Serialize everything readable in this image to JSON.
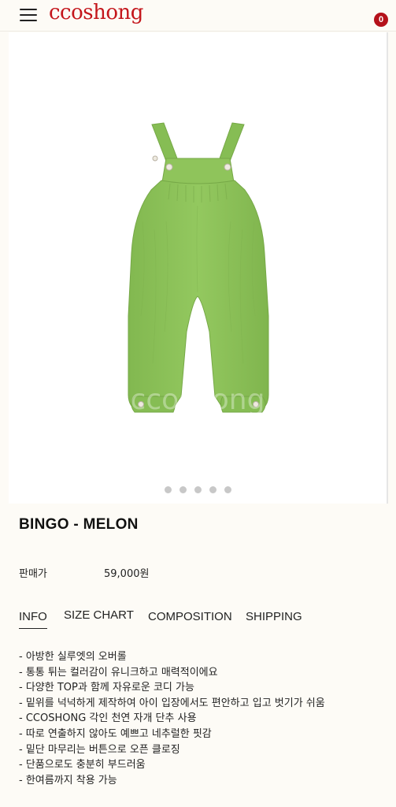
{
  "header": {
    "logo": "ccoshong",
    "cart_count": "0"
  },
  "gallery": {
    "image_alt": "Green crinkle-cotton overalls",
    "watermark": "ccoshong",
    "dot_count": 5,
    "active_index": 0
  },
  "product": {
    "title": "BINGO - MELON",
    "price_label": "판매가",
    "price_value": "59,000원"
  },
  "tabs": [
    "INFO",
    "SIZE CHART",
    "COMPOSITION",
    "SHIPPING"
  ],
  "active_tab": "INFO",
  "info_lines": [
    "- 아방한 실루엣의 오버롤",
    "- 통통 튀는 컬러감이 유니크하고 매력적이에요",
    "- 다양한 TOP과 함께 자유로운 코디 가능",
    "- 밑위를 넉넉하게 제작하여 아이 입장에서도 편안하고 입고 벗기가 쉬움",
    "- CCOSHONG 각인 천연 자개 단추 사용",
    "- 따로 연출하지 않아도 예쁘고 네추럴한 핏감",
    "- 밑단 마무리는 버튼으로 오픈 클로징",
    "- 단품으로도 충분히 부드러움",
    "- 한여름까지 착용 가능"
  ],
  "colors": {
    "brand": "#c4161c",
    "badge": "#b5121b",
    "garment": "#8ec35a"
  }
}
